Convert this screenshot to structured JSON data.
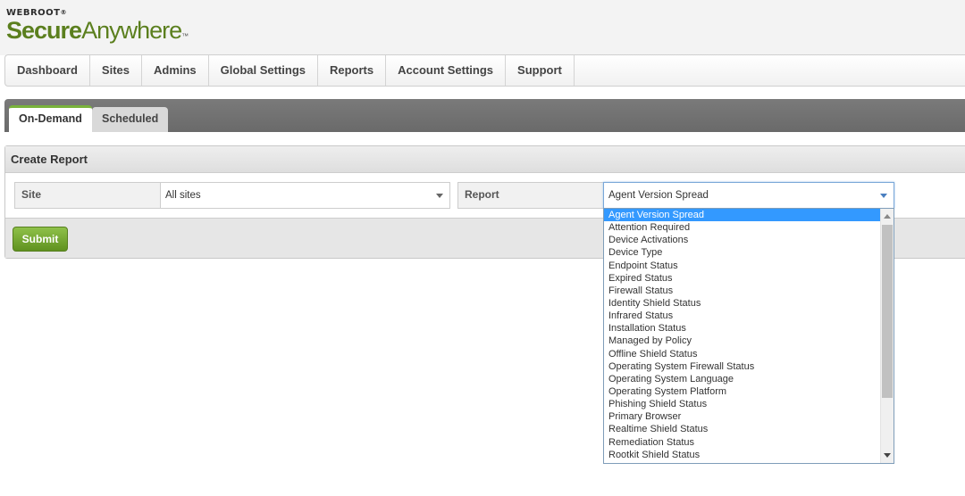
{
  "logo": {
    "brand": "WEBROOT",
    "reg": "®",
    "product_bold": "Secure",
    "product_light": "Anywhere",
    "tm": "™"
  },
  "nav": {
    "items": [
      "Dashboard",
      "Sites",
      "Admins",
      "Global Settings",
      "Reports",
      "Account Settings",
      "Support"
    ]
  },
  "tabs": {
    "active": "On-Demand",
    "inactive": "Scheduled"
  },
  "panel": {
    "title": "Create Report",
    "site": {
      "label": "Site",
      "value": "All sites"
    },
    "report": {
      "label": "Report",
      "value": "Agent Version Spread"
    },
    "submit_label": "Submit"
  },
  "dropdown": {
    "selected_index": 0,
    "options": [
      "Agent Version Spread",
      "Attention Required",
      "Device Activations",
      "Device Type",
      "Endpoint Status",
      "Expired Status",
      "Firewall Status",
      "Identity Shield Status",
      "Infrared Status",
      "Installation Status",
      "Managed by Policy",
      "Offline Shield Status",
      "Operating System Firewall Status",
      "Operating System Language",
      "Operating System Platform",
      "Phishing Shield Status",
      "Primary Browser",
      "Realtime Shield Status",
      "Remediation Status",
      "Rootkit Shield Status"
    ]
  },
  "colors": {
    "brand_green": "#5b7f1e",
    "submit_green": "#7ab33c",
    "selection_blue": "#3399ff",
    "tabbar_gray": "#707070"
  }
}
